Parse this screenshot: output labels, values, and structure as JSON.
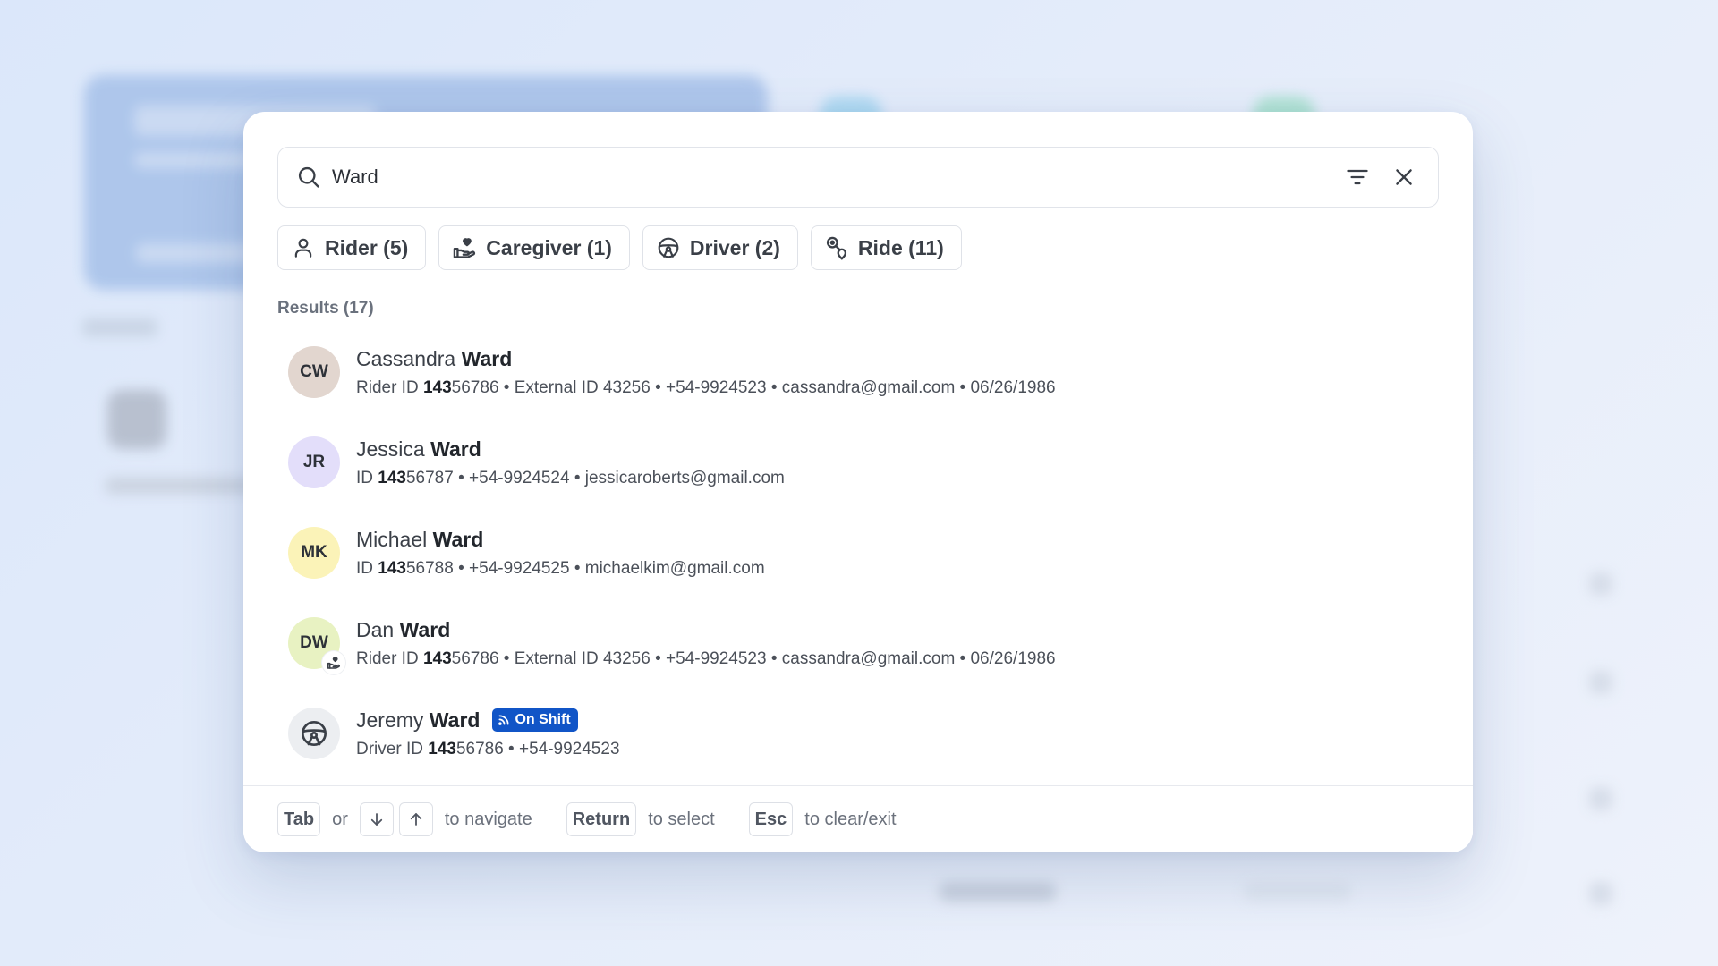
{
  "search": {
    "value": "Ward",
    "placeholder": "Search"
  },
  "filters": [
    {
      "label": "Rider (5)",
      "icon": "person-icon"
    },
    {
      "label": "Caregiver (1)",
      "icon": "caregiver-hand-heart-icon"
    },
    {
      "label": "Driver (2)",
      "icon": "steering-wheel-icon"
    },
    {
      "label": "Ride (11)",
      "icon": "route-pin-icon"
    }
  ],
  "results_heading": "Results (17)",
  "results": [
    {
      "initials": "CW",
      "avatar_color": "#e2d6cf",
      "first": "Cassandra",
      "last": "Ward",
      "meta_prefix": "Rider ID ",
      "meta_match": "143",
      "meta_rest": "56786 • External ID 43256 • +54-9924523 • cassandra@gmail.com • 06/26/1986"
    },
    {
      "initials": "JR",
      "avatar_color": "#e3defa",
      "first": "Jessica",
      "last": "Ward",
      "meta_prefix": "ID ",
      "meta_match": "143",
      "meta_rest": "56787 • +54-9924524 • jessicaroberts@gmail.com"
    },
    {
      "initials": "MK",
      "avatar_color": "#fbf3b8",
      "first": "Michael",
      "last": "Ward",
      "meta_prefix": "ID ",
      "meta_match": "143",
      "meta_rest": "56788 • +54-9924525 • michaelkim@gmail.com"
    },
    {
      "initials": "DW",
      "avatar_color": "#e8f2c2",
      "first": "Dan",
      "last": "Ward",
      "badge_icon": "caregiver-hand-heart-icon",
      "meta_prefix": "Rider ID ",
      "meta_match": "143",
      "meta_rest": "56786 • External ID 43256 • +54-9924523 • cassandra@gmail.com • 06/26/1986"
    },
    {
      "initials": "",
      "avatar_color": "#eceef1",
      "avatar_icon": "steering-wheel-icon",
      "first": "Jeremy",
      "last": "Ward",
      "status": "On Shift",
      "status_color": "#1155c7",
      "status_icon": "broadcast-icon",
      "meta_prefix": "Driver ID ",
      "meta_match": "143",
      "meta_rest": "56786 • +54-9924523"
    }
  ],
  "footer": {
    "tab_key": "Tab",
    "or_text": "or",
    "down_key_icon": "arrow-down-icon",
    "up_key_icon": "arrow-up-icon",
    "navigate_text": "to navigate",
    "return_key": "Return",
    "select_text": "to select",
    "esc_key": "Esc",
    "clear_text": "to clear/exit"
  }
}
